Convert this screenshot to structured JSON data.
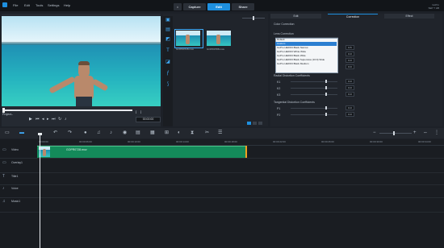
{
  "menu": {
    "items": [
      "File",
      "Edit",
      "Tools",
      "Settings",
      "Help"
    ]
  },
  "tabs": {
    "capture": "Capture",
    "edit": "Edit",
    "share": "Share"
  },
  "brand": {
    "line1": "GoPro",
    "line2": "SEP 7 HB"
  },
  "player": {
    "project_label": "Project–",
    "timecode": "00:00:00"
  },
  "library": {
    "thumbs": [
      {
        "name": "GOPR0728.mov"
      },
      {
        "name": "GOPR0788.mov"
      }
    ]
  },
  "panel": {
    "tabs": {
      "edit": "Edit",
      "correction": "Correction",
      "effect": "Effect"
    },
    "color_correction": "Color Correction",
    "lens_correction": "Lens Correction",
    "dropdown_current": "Default",
    "dropdown_options": [
      "Default",
      "Custom",
      "GoPro HERO3 Black Narrow",
      "GoPro HERO3 White Wide",
      "GoPro HERO3 Black Wide",
      "GoPro HERO3 Black Superview (16:9) Wide",
      "GoPro HERO3 Black Medium"
    ],
    "values": [
      "0.5",
      "0.0",
      "0.0",
      "0.0",
      "0.0"
    ],
    "radial": "Radial Distortion Coefficients",
    "k1": "K1",
    "k2": "K2",
    "k3": "K3",
    "tangential": "Tangential Distortion Coefficients",
    "p1": "P1",
    "p2": "P2"
  },
  "timeline": {
    "ruler": [
      "00:00:00",
      "00:00:06:00",
      "00:00:10:00",
      "00:00:14:00",
      "00:00:18:00",
      "00:00:22:00",
      "00:00:26:00",
      "00:00:30:00",
      "00:00:34:00"
    ],
    "tracks": [
      "Video",
      "Overlay1",
      "Title1",
      "Voice",
      "Music1"
    ],
    "clip_name": "GOPR0728.mov"
  }
}
